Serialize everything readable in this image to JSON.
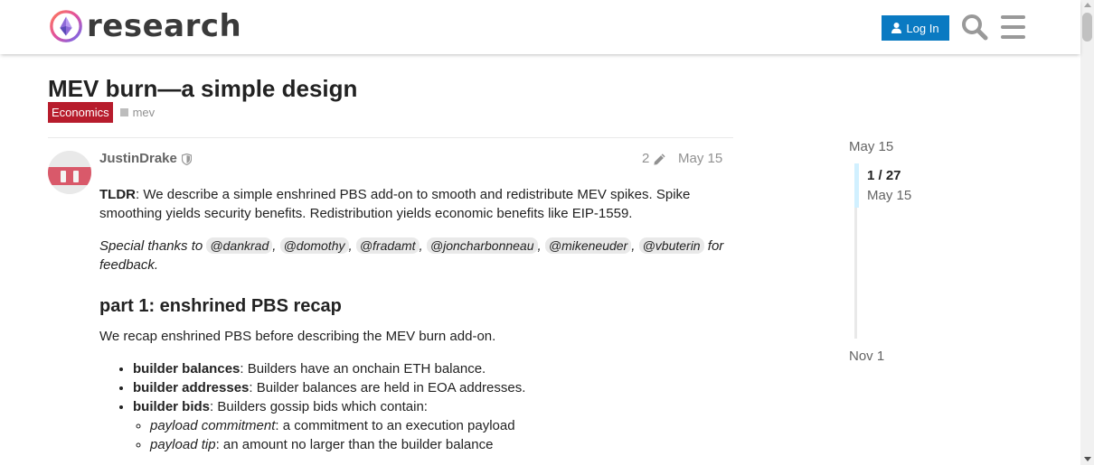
{
  "header": {
    "logo_text": "research",
    "login_label": "Log In"
  },
  "topic": {
    "title": "MEV burn—a simple design",
    "category": "Economics",
    "tag": "mev"
  },
  "post": {
    "username": "JustinDrake",
    "edit_count": "2",
    "date": "May 15",
    "tldr_label": "TLDR",
    "tldr_text": ": We describe a simple enshrined PBS add-on to smooth and redistribute MEV spikes. Spike smoothing yields security benefits. Redistribution yields economic benefits like EIP-1559.",
    "thanks_prefix": "Special thanks to",
    "mentions": [
      "@dankrad",
      "@domothy",
      "@fradamt",
      "@joncharbonneau",
      "@mikeneuder",
      "@vbuterin"
    ],
    "thanks_suffix": "for feedback.",
    "heading1": "part 1: enshrined PBS recap",
    "intro": "We recap enshrined PBS before describing the MEV burn add-on.",
    "list": [
      {
        "term": "builder balances",
        "text": ": Builders have an onchain ETH balance."
      },
      {
        "term": "builder addresses",
        "text": ": Builder balances are held in EOA addresses."
      },
      {
        "term": "builder bids",
        "text": ": Builders gossip bids which contain:"
      }
    ],
    "sublist": [
      {
        "term": "payload commitment",
        "text": ": a commitment to an execution payload"
      },
      {
        "term": "payload tip",
        "text": ": an amount no larger than the builder balance"
      }
    ]
  },
  "timeline": {
    "start_date": "May 15",
    "position": "1 / 27",
    "position_date": "May 15",
    "end_date": "Nov 1"
  }
}
